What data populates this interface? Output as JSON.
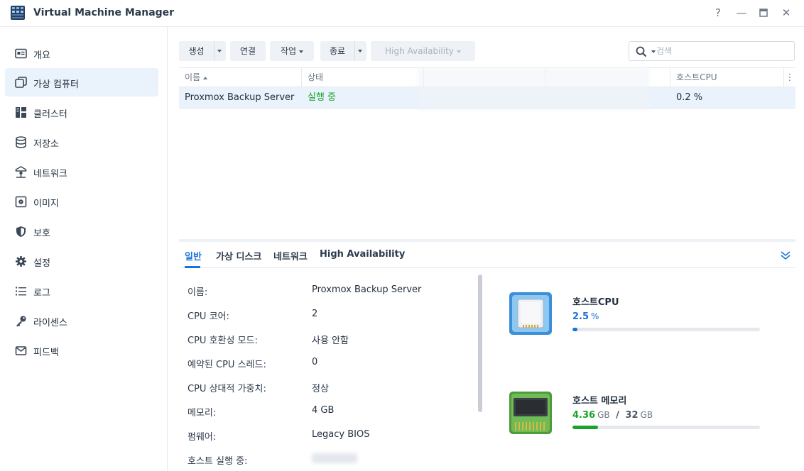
{
  "window": {
    "title": "Virtual Machine Manager",
    "help": "?",
    "minimize": "—",
    "close": "✕"
  },
  "sidebar": {
    "items": [
      {
        "label": "개요",
        "icon": "overview-icon"
      },
      {
        "label": "가상 컴퓨터",
        "icon": "virtual-machine-icon",
        "active": true
      },
      {
        "label": "클러스터",
        "icon": "cluster-icon"
      },
      {
        "label": "저장소",
        "icon": "storage-icon"
      },
      {
        "label": "네트워크",
        "icon": "network-icon"
      },
      {
        "label": "이미지",
        "icon": "image-icon"
      },
      {
        "label": "보호",
        "icon": "shield-icon"
      },
      {
        "label": "설정",
        "icon": "gear-icon"
      },
      {
        "label": "로그",
        "icon": "list-icon"
      },
      {
        "label": "라이센스",
        "icon": "key-icon"
      },
      {
        "label": "피드백",
        "icon": "mail-icon"
      }
    ]
  },
  "toolbar": {
    "create": "생성",
    "connect": "연결",
    "action": "작업",
    "shutdown": "종료",
    "high_availability": "High Availability"
  },
  "search": {
    "placeholder": "검색"
  },
  "grid": {
    "columns": [
      "이름",
      "상태",
      "",
      "",
      "호스트CPU"
    ],
    "more": "⋮",
    "rows": [
      {
        "name": "Proxmox Backup Server",
        "status": "실행 중",
        "host": "",
        "ip": "",
        "cpu": "0.2 %"
      }
    ]
  },
  "tabs": [
    "일반",
    "가상 디스크",
    "네트워크",
    "High Availability"
  ],
  "details": [
    {
      "label": "이름:",
      "value": "Proxmox Backup Server"
    },
    {
      "label": "CPU 코어:",
      "value": "2"
    },
    {
      "label": "CPU 호환성 모드:",
      "value": "사용 안함"
    },
    {
      "label": "예약된 CPU 스레드:",
      "value": "0"
    },
    {
      "label": "CPU 상대적 가중치:",
      "value": "정상"
    },
    {
      "label": "메모리:",
      "value": "4 GB"
    },
    {
      "label": "펌웨어:",
      "value": "Legacy BIOS"
    },
    {
      "label": "호스트 실행 중:",
      "value": ""
    }
  ],
  "resources": {
    "cpu": {
      "title": "호스트CPU",
      "value": "2.5",
      "unit": "%",
      "percent": 2.5,
      "color": "#1a73d9"
    },
    "memory": {
      "title": "호스트 메모리",
      "used": "4.36",
      "used_unit": "GB",
      "separator": "/",
      "total": "32",
      "total_unit": "GB",
      "percent": 13.6,
      "color": "#18a32b"
    }
  },
  "colors": {
    "accent": "#1a73d9",
    "running": "#18a32b",
    "selected_row": "#eaf2fb"
  }
}
